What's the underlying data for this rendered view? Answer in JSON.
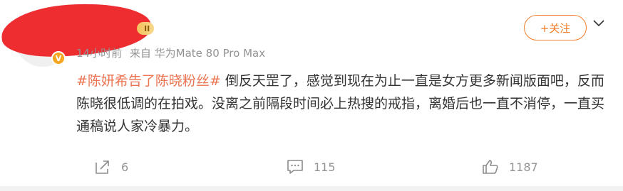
{
  "post": {
    "vip_label": "II",
    "verified_symbol": "V",
    "time": "14小时前",
    "source": "来自 华为Mate 80 Pro Max",
    "follow_label": "+关注",
    "topic": "#陈妍希告了陈晓粉丝#",
    "text": " 倒反天罡了，感觉到现在为止一直是女方更多新闻版面吧，反而陈晓很低调的在拍戏。没离之前隔段时间必上热搜的戒指，离婚后也一直不消停，一直买通稿说人家冷暴力。"
  },
  "actions": {
    "share_count": "6",
    "comment_count": "115",
    "like_count": "1187"
  },
  "colors": {
    "accent": "#f07d2b",
    "topic": "#eb7350",
    "muted": "#939393",
    "redaction": "#ee2d31"
  }
}
